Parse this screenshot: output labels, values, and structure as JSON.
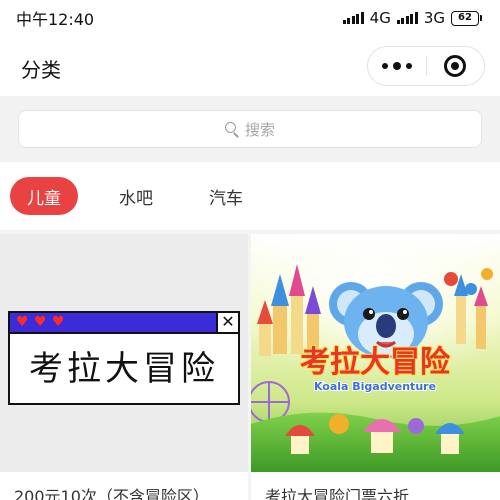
{
  "status_bar": {
    "time": "中午12:40",
    "network_1": "4G",
    "network_2": "3G",
    "battery": "62"
  },
  "nav": {
    "title": "分类"
  },
  "search": {
    "placeholder": "搜索"
  },
  "tabs": [
    {
      "label": "儿童",
      "active": true
    },
    {
      "label": "水吧",
      "active": false
    },
    {
      "label": "汽车",
      "active": false
    }
  ],
  "cards": [
    {
      "title": "200元10次（不含冒险区）",
      "image_text": "考拉大冒险"
    },
    {
      "title": "考拉大冒险门票六折",
      "image_text": "考拉大冒险",
      "image_subtext": "Koala Bigadventure"
    }
  ],
  "colors": {
    "accent": "#e94242",
    "banner_bar": "#3b2bd8",
    "heart": "#ff2a2a"
  }
}
